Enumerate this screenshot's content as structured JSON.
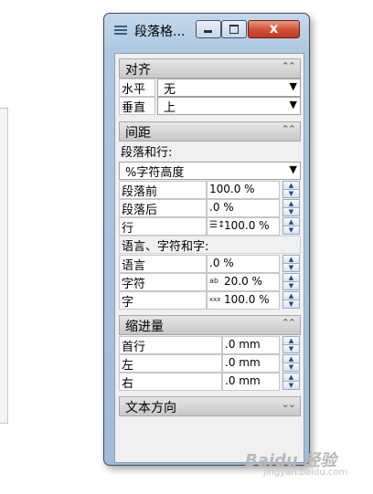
{
  "window": {
    "title": "段落格...",
    "close_glyph": "x"
  },
  "alignment": {
    "header": "对齐",
    "chevron": "⌃⌃",
    "horizontal_label": "水平",
    "horizontal_value": "无",
    "vertical_label": "垂直",
    "vertical_value": "上"
  },
  "spacing": {
    "header": "间距",
    "chevron": "⌃⌃",
    "paragraph_and_line_label": "段落和行:",
    "mode_value": "%字符高度",
    "before_label": "段落前",
    "before_value": "100.0 %",
    "after_label": "段落后",
    "after_value": ".0 %",
    "line_label": "行",
    "line_value": "100.0 %",
    "lang_char_word_label": "语言、字符和字:",
    "language_label": "语言",
    "language_value": ".0 %",
    "character_label": "字符",
    "character_value": "20.0 %",
    "word_label": "字",
    "word_value": "100.0 %"
  },
  "indent": {
    "header": "缩进量",
    "chevron": "⌃⌃",
    "first_line_label": "首行",
    "first_line_value": ".0 mm",
    "left_label": "左",
    "left_value": ".0 mm",
    "right_label": "右",
    "right_value": ".0 mm"
  },
  "text_direction": {
    "header": "文本方向",
    "chevron": "⌄⌄"
  },
  "icons": {
    "combo_arrow": "▼",
    "spin_up": "▲",
    "spin_down": "▼",
    "line_spacing": "☰↕",
    "char_spacing": "ab",
    "word_spacing": "xxx"
  },
  "watermark": {
    "brand": "Baidu 经验",
    "url": "jingyan.baidu.com"
  }
}
